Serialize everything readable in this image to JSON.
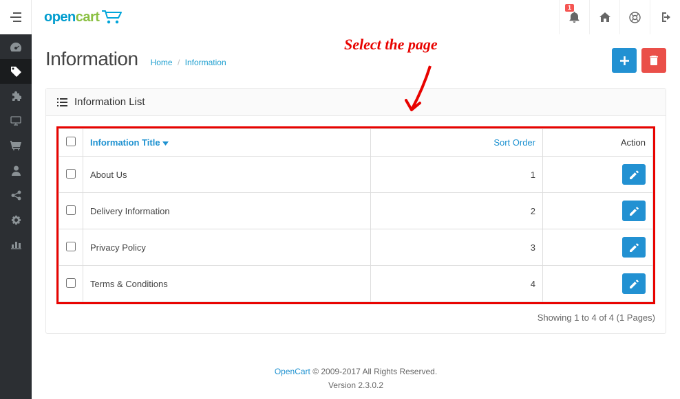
{
  "annotation": {
    "text": "Select the page"
  },
  "header": {
    "logo_open": "open",
    "logo_cart": "cart",
    "notification_count": "1"
  },
  "page": {
    "title": "Information",
    "breadcrumb": {
      "home": "Home",
      "current": "Information"
    }
  },
  "panel": {
    "title": "Information List"
  },
  "table": {
    "headers": {
      "title": "Information Title",
      "sort": "Sort Order",
      "action": "Action"
    },
    "rows": [
      {
        "title": "About Us",
        "sort": "1"
      },
      {
        "title": "Delivery Information",
        "sort": "2"
      },
      {
        "title": "Privacy Policy",
        "sort": "3"
      },
      {
        "title": "Terms & Conditions",
        "sort": "4"
      }
    ]
  },
  "results_text": "Showing 1 to 4 of 4 (1 Pages)",
  "footer": {
    "brand": "OpenCart",
    "rights": " © 2009-2017 All Rights Reserved.",
    "version": "Version 2.3.0.2"
  }
}
